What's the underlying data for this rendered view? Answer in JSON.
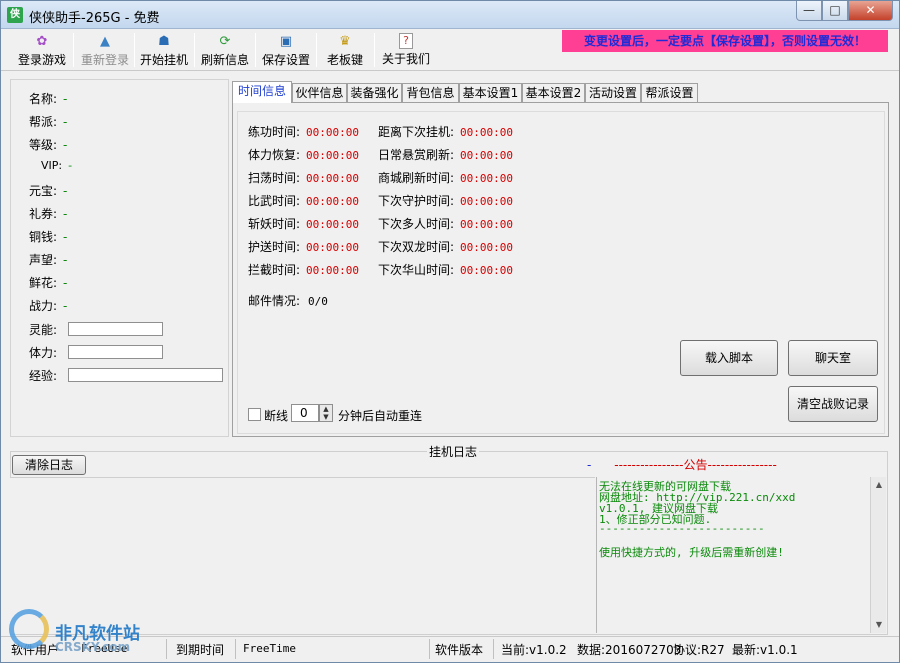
{
  "window": {
    "title": "侠侠助手-265G - 免费",
    "icon_text": "侠"
  },
  "toolbar": {
    "items": [
      {
        "label": "登录游戏",
        "icon": "game-pad-icon",
        "disabled": false
      },
      {
        "label": "重新登录",
        "icon": "up-arrow-icon",
        "disabled": true
      },
      {
        "label": "开始挂机",
        "icon": "person-icon",
        "disabled": false
      },
      {
        "label": "刷新信息",
        "icon": "refresh-icon",
        "disabled": false
      },
      {
        "label": "保存设置",
        "icon": "save-icon",
        "disabled": false
      },
      {
        "label": "老板键",
        "icon": "boss-key-icon",
        "disabled": false
      },
      {
        "label": "关于我们",
        "icon": "help-icon",
        "disabled": false
      }
    ],
    "warning": "变更设置后，一定要点【保存设置】，否则设置无效！"
  },
  "left_panel": {
    "rows": [
      {
        "label": "名称:",
        "value": "-"
      },
      {
        "label": "帮派:",
        "value": "-"
      },
      {
        "label": "等级:",
        "value": "-"
      },
      {
        "label": "VIP:",
        "value": "-"
      },
      {
        "label": "元宝:",
        "value": "-"
      },
      {
        "label": "礼券:",
        "value": "-"
      },
      {
        "label": "铜钱:",
        "value": "-"
      },
      {
        "label": "声望:",
        "value": "-"
      },
      {
        "label": "鲜花:",
        "value": "-"
      },
      {
        "label": "战力:",
        "value": "-"
      }
    ],
    "bars": [
      {
        "label": "灵能:"
      },
      {
        "label": "体力:"
      },
      {
        "label": "经验:"
      }
    ]
  },
  "tabs": [
    "时间信息",
    "伙伴信息",
    "装备强化",
    "背包信息",
    "基本设置1",
    "基本设置2",
    "活动设置",
    "帮派设置"
  ],
  "time_info": {
    "left": [
      {
        "label": "练功时间:",
        "time": "00:00:00"
      },
      {
        "label": "体力恢复:",
        "time": "00:00:00"
      },
      {
        "label": "扫荡时间:",
        "time": "00:00:00"
      },
      {
        "label": "比武时间:",
        "time": "00:00:00"
      },
      {
        "label": "斩妖时间:",
        "time": "00:00:00"
      },
      {
        "label": "护送时间:",
        "time": "00:00:00"
      },
      {
        "label": "拦截时间:",
        "time": "00:00:00"
      }
    ],
    "right": [
      {
        "label": "距离下次挂机:",
        "time": "00:00:00"
      },
      {
        "label": "日常悬赏刷新:",
        "time": "00:00:00"
      },
      {
        "label": "商城刷新时间:",
        "time": "00:00:00"
      },
      {
        "label": "下次守护时间:",
        "time": "00:00:00"
      },
      {
        "label": "下次多人时间:",
        "time": "00:00:00"
      },
      {
        "label": "下次双龙时间:",
        "time": "00:00:00"
      },
      {
        "label": "下次华山时间:",
        "time": "00:00:00"
      }
    ],
    "mail": {
      "label": "邮件情况:",
      "value": "0/0"
    },
    "buttons": {
      "load_script": "载入脚本",
      "chat_room": "聊天室",
      "clear_battle": "清空战败记录"
    },
    "reconnect": {
      "label": "断线",
      "minutes": "0",
      "suffix": "分钟后自动重连"
    }
  },
  "log": {
    "title": "挂机日志",
    "clear_button": "清除日志",
    "notice_left_dash": "-",
    "notice_header": "----------------公告----------------",
    "notice_lines": [
      "无法在线更新的可网盘下载",
      "网盘地址: http://vip.221.cn/xxd",
      "v1.0.1, 建议网盘下载",
      "1、修正部分已知问题.",
      "-------------------------",
      "",
      "使用快捷方式的, 升级后需重新创建!"
    ]
  },
  "statusbar": {
    "user_label": "软件用户",
    "user_value": "FreeUse",
    "expire_label": "到期时间",
    "expire_value": "FreeTime",
    "version_label": "软件版本",
    "current": "当前:v1.0.2",
    "data": "数据:2016072703",
    "protocol": "协议:R27",
    "latest": "最新:v1.0.1"
  },
  "watermark": {
    "text1": "非凡软件站",
    "text2": "CRSKY.com"
  }
}
